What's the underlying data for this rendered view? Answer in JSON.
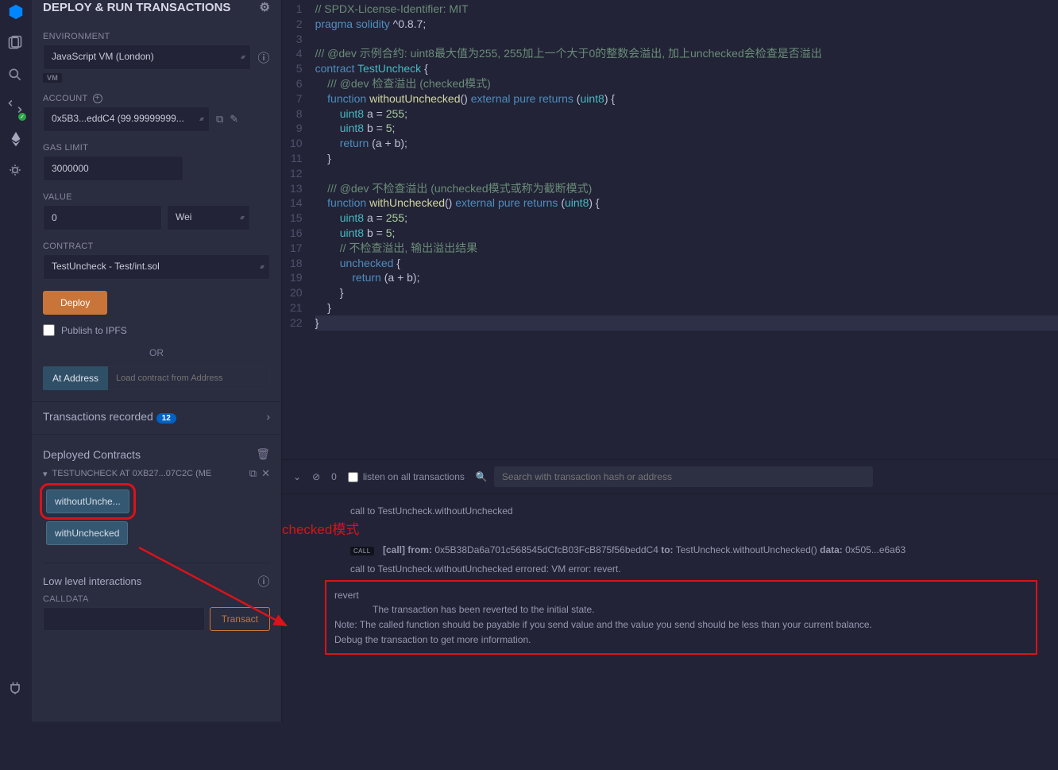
{
  "panel_title": "DEPLOY & RUN TRANSACTIONS",
  "env": {
    "label": "ENVIRONMENT",
    "value": "JavaScript VM (London)",
    "chip": "VM"
  },
  "account": {
    "label": "ACCOUNT",
    "value": "0x5B3...eddC4 (99.99999999..."
  },
  "gas": {
    "label": "GAS LIMIT",
    "value": "3000000"
  },
  "val": {
    "label": "VALUE",
    "amount": "0",
    "unit": "Wei"
  },
  "contract": {
    "label": "CONTRACT",
    "value": "TestUncheck - Test/int.sol"
  },
  "deploy_label": "Deploy",
  "publish_label": "Publish to IPFS",
  "or": "OR",
  "ataddr": {
    "btn": "At Address",
    "placeholder": "Load contract from Address"
  },
  "txrec": {
    "label": "Transactions recorded",
    "count": "12"
  },
  "deployed": {
    "title": "Deployed Contracts",
    "instance": "TESTUNCHECK AT 0XB27...07C2C (ME",
    "fn_without": "withoutUnche...",
    "fn_with": "withUnchecked",
    "lowlvl": "Low level interactions",
    "calldata": "CALLDATA",
    "transact": "Transact"
  },
  "term": {
    "count": "0",
    "listen": "listen on all transactions",
    "search_placeholder": "Search with transaction hash or address",
    "annot": "checked模式",
    "log1": "call to TestUncheck.withoutUnchecked",
    "log2a": "[call]  from:",
    "log2b": "0x5B38Da6a701c568545dCfcB03FcB875f56beddC4",
    "log2c": "to:",
    "log2d": "TestUncheck.withoutUnchecked()",
    "log2e": "data:",
    "log2f": "0x505...e6a63",
    "log3": "call to TestUncheck.withoutUnchecked errored: VM error: revert.",
    "rev_head": "revert",
    "rev_l1": "The transaction has been reverted to the initial state.",
    "rev_l2": "Note: The called function should be payable if you send value and the value you send should be less than your current balance.",
    "rev_l3": "Debug the transaction to get more information."
  },
  "code": {
    "lines": [
      {
        "n": 1,
        "html": "<span class='c-c'>// SPDX-License-Identifier: MIT</span>"
      },
      {
        "n": 2,
        "html": "<span class='c-k'>pragma</span> <span class='c-k'>solidity</span> ^0.8.7;"
      },
      {
        "n": 3,
        "html": ""
      },
      {
        "n": 4,
        "html": "<span class='c-c'>/// @dev 示例合约: uint8最大值为255, 255加上一个大于0的整数会溢出, 加上unchecked会检查是否溢出</span>"
      },
      {
        "n": 5,
        "html": "<span class='c-k'>contract</span> <span class='c-t'>TestUncheck</span> {"
      },
      {
        "n": 6,
        "html": "    <span class='c-c'>/// @dev 检查溢出 (checked模式)</span>"
      },
      {
        "n": 7,
        "html": "    <span class='c-k'>function</span> <span class='c-fn'>withoutUnchecked</span>() <span class='c-k'>external</span> <span class='c-k'>pure</span> <span class='c-k'>returns</span> (<span class='c-t'>uint8</span>) {"
      },
      {
        "n": 8,
        "html": "        <span class='c-t'>uint8</span> a = <span class='c-n'>255</span>;"
      },
      {
        "n": 9,
        "html": "        <span class='c-t'>uint8</span> b = <span class='c-n'>5</span>;"
      },
      {
        "n": 10,
        "html": "        <span class='c-k'>return</span> (a + b);"
      },
      {
        "n": 11,
        "html": "    }"
      },
      {
        "n": 12,
        "html": ""
      },
      {
        "n": 13,
        "html": "    <span class='c-c'>/// @dev 不检查溢出 (unchecked模式或称为截断模式)</span>"
      },
      {
        "n": 14,
        "html": "    <span class='c-k'>function</span> <span class='c-fn'>withUnchecked</span>() <span class='c-k'>external</span> <span class='c-k'>pure</span> <span class='c-k'>returns</span> (<span class='c-t'>uint8</span>) {"
      },
      {
        "n": 15,
        "html": "        <span class='c-t'>uint8</span> a = <span class='c-n'>255</span>;"
      },
      {
        "n": 16,
        "html": "        <span class='c-t'>uint8</span> b = <span class='c-n'>5</span>;"
      },
      {
        "n": 17,
        "html": "        <span class='c-c'>// 不检查溢出, 输出溢出结果</span>"
      },
      {
        "n": 18,
        "html": "        <span class='c-k'>unchecked</span> {"
      },
      {
        "n": 19,
        "html": "            <span class='c-k'>return</span> (a + b);"
      },
      {
        "n": 20,
        "html": "        }"
      },
      {
        "n": 21,
        "html": "    }"
      },
      {
        "n": 22,
        "html": "}",
        "active": true
      }
    ]
  }
}
